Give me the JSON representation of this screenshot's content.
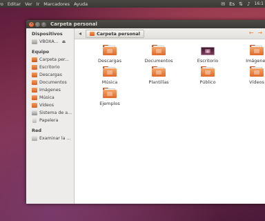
{
  "menubar": {
    "items": [
      "vo",
      "Editar",
      "Ver",
      "Ir",
      "Marcadores",
      "Ayuda"
    ],
    "tray": {
      "mail_icon": "envelope-icon",
      "keyboard": "Es",
      "network_icon": "network-icon",
      "volume_icon": "speaker-icon",
      "clock": "16:1"
    }
  },
  "window": {
    "title": "Carpeta personal",
    "buttons": [
      "close",
      "minimize",
      "maximize"
    ]
  },
  "sidebar": {
    "sections": [
      {
        "header": "Dispositivos",
        "items": [
          {
            "label": "VBOXA...",
            "icon": "drive-icon"
          }
        ]
      },
      {
        "header": "Equipo",
        "items": [
          {
            "label": "Carpeta per...",
            "icon": "home-folder-icon"
          },
          {
            "label": "Escritorio",
            "icon": "folder-icon"
          },
          {
            "label": "Descargas",
            "icon": "folder-icon"
          },
          {
            "label": "Documentos",
            "icon": "folder-icon"
          },
          {
            "label": "Imágenes",
            "icon": "folder-icon"
          },
          {
            "label": "Música",
            "icon": "folder-icon"
          },
          {
            "label": "Vídeos",
            "icon": "folder-icon"
          },
          {
            "label": "Sistema de a...",
            "icon": "disk-icon"
          },
          {
            "label": "Papelera",
            "icon": "trash-icon"
          }
        ]
      },
      {
        "header": "Red",
        "items": [
          {
            "label": "Examinar la ...",
            "icon": "network-icon"
          }
        ]
      }
    ]
  },
  "toolbar": {
    "breadcrumb": "Carpeta personal"
  },
  "files": [
    {
      "label": "Descargas"
    },
    {
      "label": "Documentos"
    },
    {
      "label": "Escritorio"
    },
    {
      "label": "Imágenes"
    },
    {
      "label": "Música"
    },
    {
      "label": "Plantillas"
    },
    {
      "label": "Público"
    },
    {
      "label": "Vídeos"
    },
    {
      "label": "Ejemplos"
    }
  ],
  "colors": {
    "accent": "#e95420",
    "folder": "#df6a2a",
    "panel": "#3c3b37"
  }
}
